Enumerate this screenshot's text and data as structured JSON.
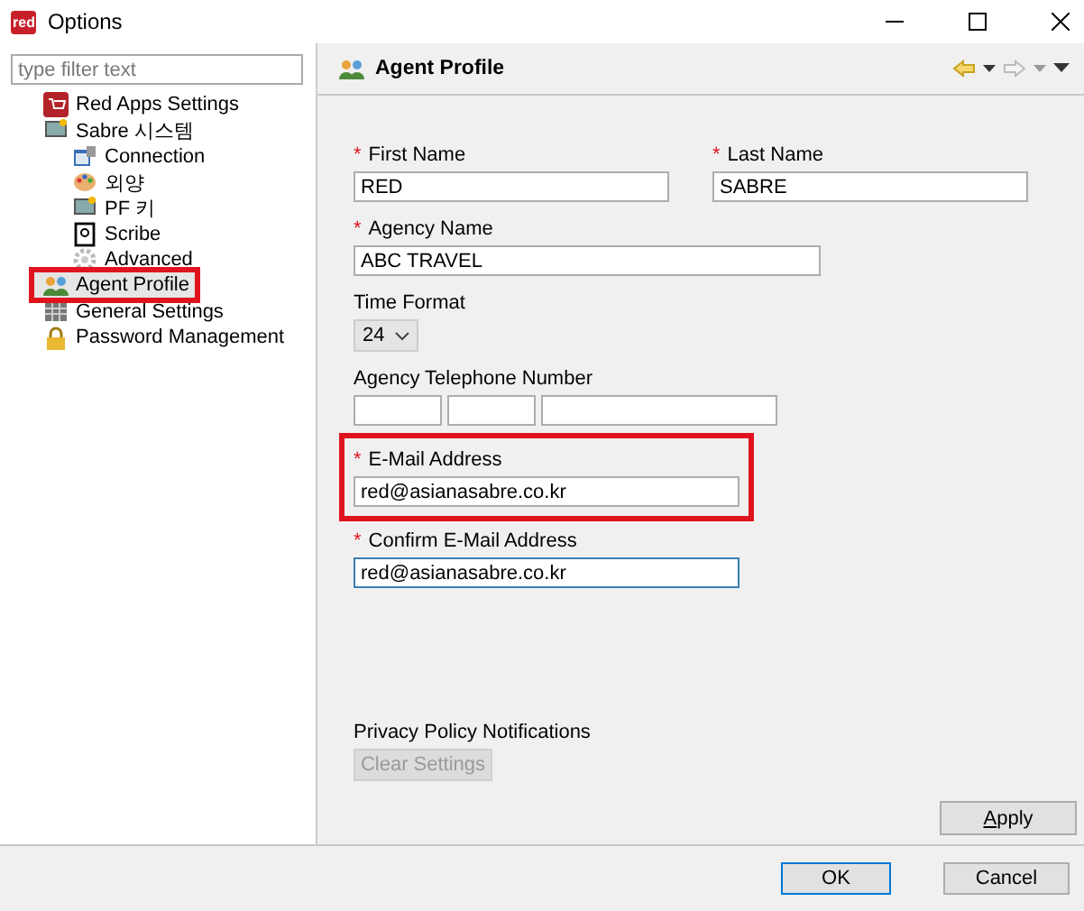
{
  "window": {
    "logo": "red",
    "title": "Options"
  },
  "filter": {
    "placeholder": "type filter text"
  },
  "tree": [
    {
      "label": "Red Apps Settings",
      "selected": false,
      "highlighted": false
    },
    {
      "label": "Sabre 시스템",
      "selected": false,
      "highlighted": false,
      "children": [
        {
          "label": "Connection",
          "selected": false,
          "highlighted": false
        },
        {
          "label": "외양",
          "selected": false,
          "highlighted": false
        },
        {
          "label": "PF 키",
          "selected": false,
          "highlighted": false
        },
        {
          "label": "Scribe",
          "selected": false,
          "highlighted": false
        },
        {
          "label": "Advanced",
          "selected": false,
          "highlighted": false
        }
      ]
    },
    {
      "label": "Agent Profile",
      "selected": true,
      "highlighted": true
    },
    {
      "label": "General Settings",
      "selected": false,
      "highlighted": false
    },
    {
      "label": "Password Management",
      "selected": false,
      "highlighted": false
    }
  ],
  "page": {
    "title": "Agent Profile",
    "back_disabled": false,
    "forward_disabled": true
  },
  "form": [
    {
      "fields": [
        {
          "kind": "name",
          "marker": "*",
          "label": "First Name",
          "value": "RED"
        },
        {
          "kind": "name",
          "marker": "*",
          "label": "Last Name",
          "value": "SABRE"
        }
      ]
    },
    {
      "fields": [
        {
          "kind": "text",
          "marker": "*",
          "label": "Agency Name",
          "value": "ABC TRAVEL"
        }
      ]
    },
    {
      "fields": [
        {
          "kind": "select",
          "label": "Time Format",
          "value": "24"
        }
      ]
    },
    {
      "fields": [
        {
          "kind": "phone",
          "label": "Agency Telephone Number"
        }
      ]
    },
    {
      "fields": [
        {
          "kind": "email",
          "marker": "*",
          "label": "E-Mail Address",
          "value": "red@asianasabre.co.kr",
          "highlighted": true,
          "focused": false
        }
      ]
    },
    {
      "fields": [
        {
          "kind": "email",
          "marker": "*",
          "label": "Confirm E-Mail Address",
          "value": "red@asianasabre.co.kr",
          "focused": true
        }
      ]
    }
  ],
  "privacy": {
    "label": "Privacy Policy Notifications",
    "button": {
      "label": "Clear Settings",
      "disabled": true
    }
  },
  "apply": {
    "label": "Apply"
  },
  "buttons": [
    {
      "label": "OK",
      "default": true
    },
    {
      "label": "Cancel",
      "default": false
    }
  ]
}
